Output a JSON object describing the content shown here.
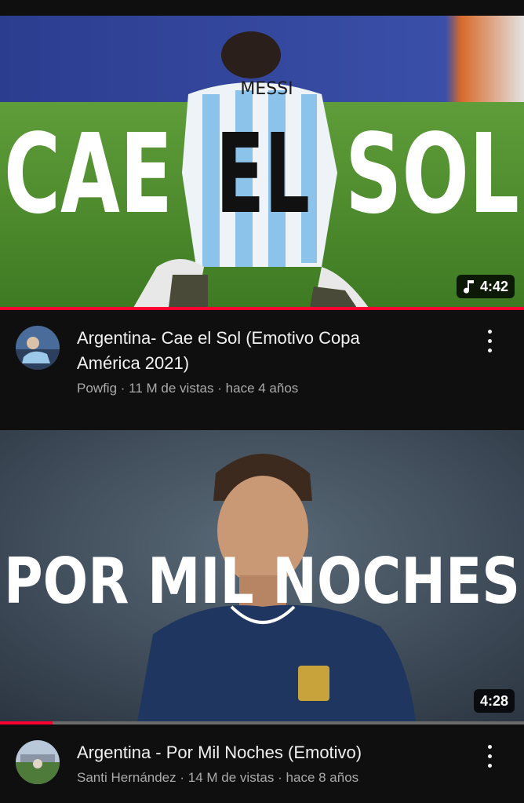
{
  "videos": [
    {
      "thumbnail_text": [
        "CAE",
        "EL",
        "SOL"
      ],
      "jersey_name": "MESSI",
      "duration": "4:42",
      "duration_icon": "music-note-icon",
      "progress_fraction": 1.0,
      "title_line1": "Argentina- Cae el Sol (Emotivo Copa",
      "title_line2": "América 2021)",
      "channel": "Powfig",
      "views": "11 M de vistas",
      "age": "hace 4 años",
      "separator": "·"
    },
    {
      "thumbnail_text": "POR MIL NOCHES",
      "duration": "4:28",
      "progress_fraction": 0.1,
      "title": "Argentina - Por Mil Noches (Emotivo)",
      "channel": "Santi Hernández",
      "views": "14 M de vistas",
      "age": "hace 8 años",
      "separator": "·"
    }
  ],
  "colors": {
    "background": "#0f0f0f",
    "progress_red": "#ff0033",
    "secondary_text": "#aaaaaa"
  }
}
